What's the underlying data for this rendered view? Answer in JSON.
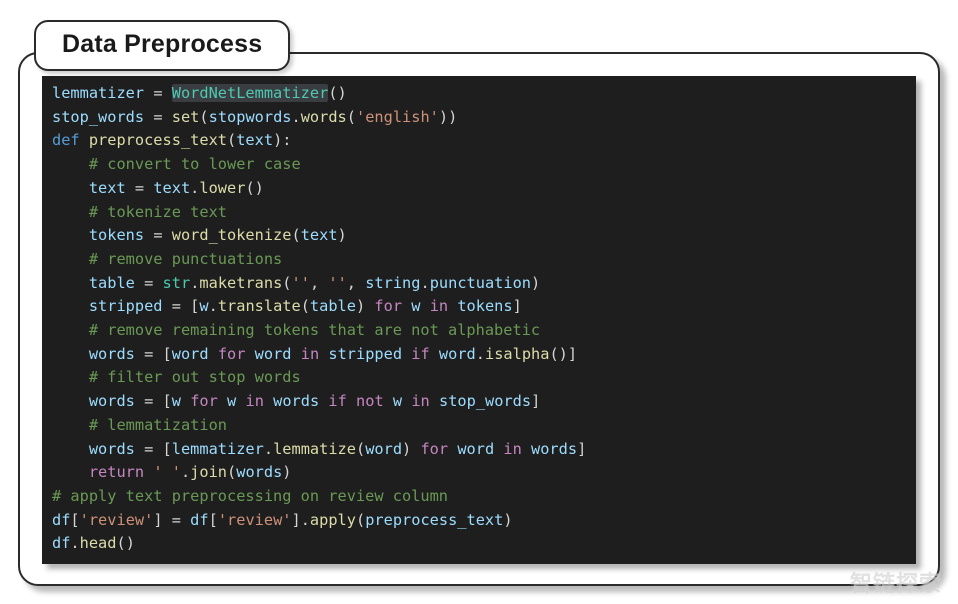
{
  "title": "Data Preprocess",
  "watermark": "智链探索",
  "code": {
    "l1": {
      "var": "lemmatizer",
      "eq": " = ",
      "cls": "WordNetLemmatizer",
      "paren": "()"
    },
    "l2": {
      "var": "stop_words",
      "eq": " = ",
      "fn": "set",
      "p1": "(",
      "obj": "stopwords",
      "dot": ".",
      "m": "words",
      "p2": "(",
      "str": "'english'",
      "p3": "))"
    },
    "l3": {
      "kw": "def ",
      "fn": "preprocess_text",
      "p1": "(",
      "arg": "text",
      "p2": "):"
    },
    "c1": "# convert to lower case",
    "l4": {
      "var": "text",
      "eq": " = ",
      "obj": "text",
      "dot": ".",
      "m": "lower",
      "p": "()"
    },
    "c2": "# tokenize text",
    "l5": {
      "var": "tokens",
      "eq": " = ",
      "fn": "word_tokenize",
      "p1": "(",
      "arg": "text",
      "p2": ")"
    },
    "c3": "# remove punctuations",
    "l6": {
      "var": "table",
      "eq": " = ",
      "cls": "str",
      "dot": ".",
      "m": "maketrans",
      "p1": "(",
      "s1": "''",
      "c1": ", ",
      "s2": "''",
      "c2": ", ",
      "obj": "string",
      "dot2": ".",
      "attr": "punctuation",
      "p2": ")"
    },
    "l7": {
      "var": "stripped",
      "eq": " = [",
      "obj": "w",
      "dot": ".",
      "m": "translate",
      "p1": "(",
      "arg": "table",
      "p2": ") ",
      "for": "for",
      "sp1": " ",
      "it": "w",
      "sp2": " ",
      "in": "in",
      "sp3": " ",
      "src": "tokens",
      "end": "]"
    },
    "c4": "# remove remaining tokens that are not alphabetic",
    "l8": {
      "var": "words",
      "eq": " = [",
      "it": "word",
      "sp1": " ",
      "for": "for",
      "sp2": " ",
      "it2": "word",
      "sp3": " ",
      "in": "in",
      "sp4": " ",
      "src": "stripped",
      "sp5": " ",
      "if": "if",
      "sp6": " ",
      "obj": "word",
      "dot": ".",
      "m": "isalpha",
      "p": "()]"
    },
    "c5": "# filter out stop words",
    "l9": {
      "var": "words",
      "eq": " = [",
      "it": "w",
      "sp1": " ",
      "for": "for",
      "sp2": " ",
      "it2": "w",
      "sp3": " ",
      "in": "in",
      "sp4": " ",
      "src": "words",
      "sp5": " ",
      "if": "if",
      "sp6": " ",
      "not": "not",
      "sp7": " ",
      "it3": "w",
      "sp8": " ",
      "in2": "in",
      "sp9": " ",
      "src2": "stop_words",
      "end": "]"
    },
    "c6": "# lemmatization",
    "l10": {
      "var": "words",
      "eq": " = [",
      "obj": "lemmatizer",
      "dot": ".",
      "m": "lemmatize",
      "p1": "(",
      "arg": "word",
      "p2": ") ",
      "for": "for",
      "sp1": " ",
      "it": "word",
      "sp2": " ",
      "in": "in",
      "sp3": " ",
      "src": "words",
      "end": "]"
    },
    "l11": {
      "ret": "return ",
      "str": "' '",
      "dot": ".",
      "m": "join",
      "p1": "(",
      "arg": "words",
      "p2": ")"
    },
    "c7": "# apply text preprocessing on review column",
    "l12": {
      "obj": "df",
      "b1": "[",
      "s1": "'review'",
      "b2": "] = ",
      "obj2": "df",
      "b3": "[",
      "s2": "'review'",
      "b4": "].",
      "m": "apply",
      "p1": "(",
      "arg": "preprocess_text",
      "p2": ")"
    },
    "l13": {
      "obj": "df",
      "dot": ".",
      "m": "head",
      "p": "()"
    }
  }
}
